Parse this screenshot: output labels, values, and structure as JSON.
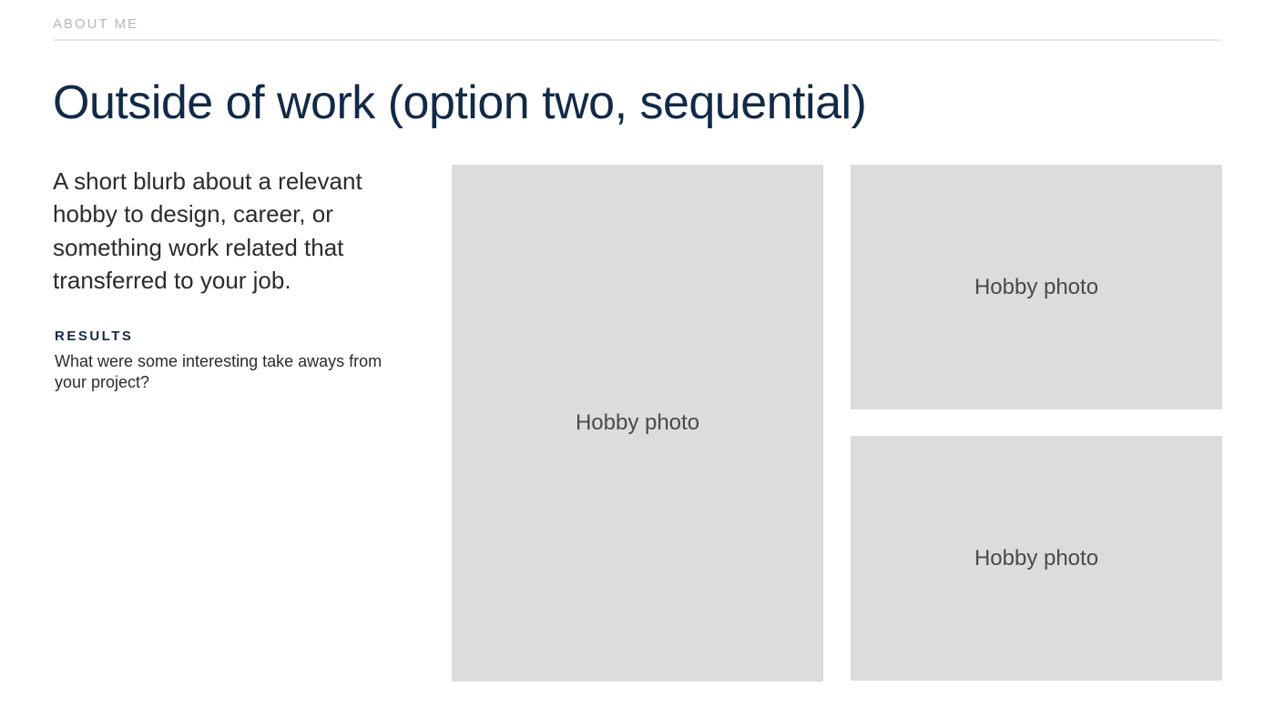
{
  "eyebrow": "ABOUT ME",
  "title": "Outside of work (option two, sequential)",
  "blurb": "A short blurb about a relevant hobby to design, career, or something work related that transferred to your job.",
  "results": {
    "heading": "RESULTS",
    "body": "What were some interesting take aways from your project?"
  },
  "photos": {
    "large": "Hobby photo",
    "top_right": "Hobby photo",
    "bottom_right": "Hobby photo"
  }
}
